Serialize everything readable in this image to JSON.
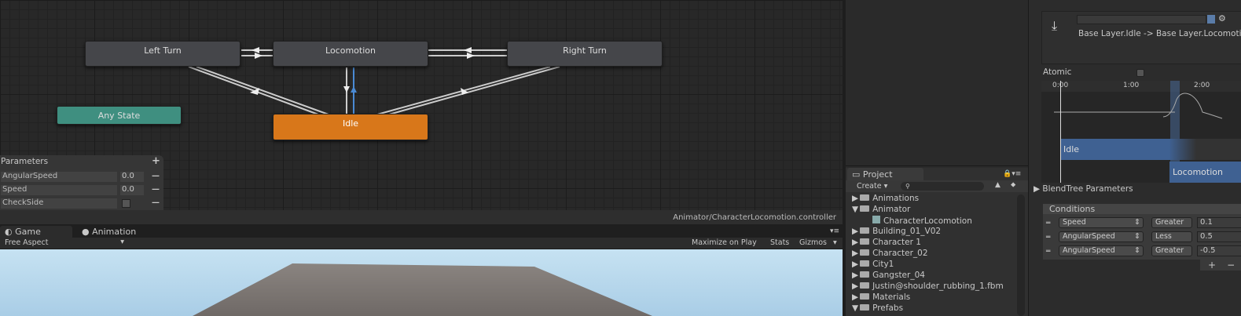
{
  "animator": {
    "states": {
      "left_turn": "Left Turn",
      "locomotion": "Locomotion",
      "right_turn": "Right Turn",
      "any_state": "Any State",
      "idle": "Idle"
    },
    "parameters": {
      "title": "Parameters",
      "add": "+",
      "items": [
        {
          "name": "AngularSpeed",
          "value": "0.0"
        },
        {
          "name": "Speed",
          "value": "0.0"
        },
        {
          "name": "CheckSide",
          "value": false
        }
      ],
      "remove": "—"
    },
    "footer_path": "Animator/CharacterLocomotion.controller",
    "colors": {
      "any_state": "#3f8f80",
      "idle": "#d8771a",
      "transition_selected": "#4a8ad4"
    }
  },
  "tabs": [
    {
      "label": "Game"
    },
    {
      "label": "Animation"
    }
  ],
  "game_toolbar": {
    "aspect": "Free Aspect",
    "maximize": "Maximize on Play",
    "stats": "Stats",
    "gizmos": "Gizmos"
  },
  "project": {
    "tab": "Project",
    "create": "Create",
    "items": [
      {
        "label": "Animations",
        "expanded": false
      },
      {
        "label": "Animator",
        "expanded": true
      },
      {
        "label": "CharacterLocomotion",
        "child": true
      },
      {
        "label": "Building_01_V02"
      },
      {
        "label": "Character 1"
      },
      {
        "label": "Character_02"
      },
      {
        "label": "City1"
      },
      {
        "label": "Gangster_04"
      },
      {
        "label": "Justin@shoulder_rubbing_1.fbm"
      },
      {
        "label": "Materials"
      },
      {
        "label": "Prefabs",
        "expanded": true
      }
    ]
  },
  "inspector": {
    "transition_label": "Base Layer.Idle -> Base Layer.Locomotion",
    "atomic": "Atomic",
    "timeline": {
      "ticks": [
        "0:00",
        "1:00",
        "2:00"
      ],
      "from_state": "Idle",
      "to_state": "Locomotion"
    },
    "blendtree": "BlendTree Parameters",
    "conditions": {
      "title": "Conditions",
      "rows": [
        {
          "param": "Speed",
          "op": "Greater",
          "value": "0.1"
        },
        {
          "param": "AngularSpeed",
          "op": "Less",
          "value": "0.5"
        },
        {
          "param": "AngularSpeed",
          "op": "Greater",
          "value": "-0.5"
        }
      ],
      "add": "+",
      "remove": "−"
    }
  }
}
